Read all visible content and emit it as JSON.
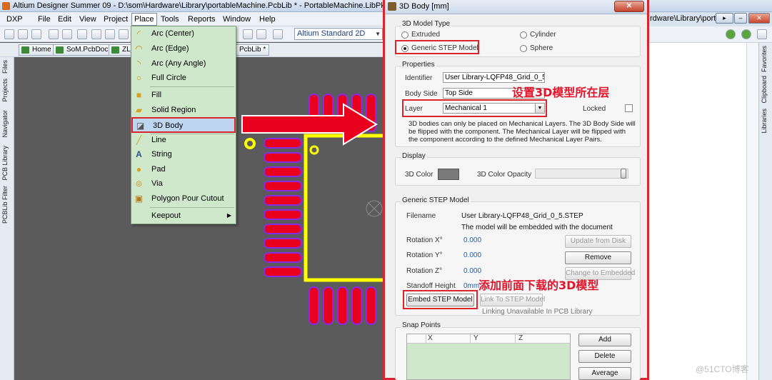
{
  "app": {
    "title": "Altium Designer Summer 09 - D:\\som\\Hardware\\Library\\portableMachine.PcbLib * - PortableMachine.LibPkg. Lice",
    "right_path": "rdware\\Library\\porta"
  },
  "menubar": [
    "DXP",
    "File",
    "Edit",
    "View",
    "Project",
    "Place",
    "Tools",
    "Reports",
    "Window",
    "Help"
  ],
  "toolbar": {
    "view_combo": "Altium Standard 2D"
  },
  "doc_tabs": [
    {
      "label": "Home"
    },
    {
      "label": "SoM.PcbDoc *"
    },
    {
      "label": "ZL_"
    },
    {
      "label": "PcbLib *"
    }
  ],
  "left_panel_tabs": [
    "Files",
    "Projects",
    "Navigator",
    "PCB Library",
    "PCBLib Filter"
  ],
  "right_panel_tabs": [
    "Favorites",
    "Clipboard",
    "Libraries"
  ],
  "place_menu": {
    "items": [
      {
        "label": "Arc (Center)",
        "icon": "arc-center-icon"
      },
      {
        "label": "Arc (Edge)",
        "icon": "arc-edge-icon"
      },
      {
        "label": "Arc (Any Angle)",
        "icon": "arc-any-angle-icon"
      },
      {
        "label": "Full Circle",
        "icon": "full-circle-icon"
      },
      {
        "label": "Fill",
        "icon": "fill-icon"
      },
      {
        "label": "Solid Region",
        "icon": "solid-region-icon"
      },
      {
        "label": "3D Body",
        "icon": "3d-body-icon",
        "selected": true
      },
      {
        "label": "Line",
        "icon": "line-icon"
      },
      {
        "label": "String",
        "icon": "string-icon"
      },
      {
        "label": "Pad",
        "icon": "pad-icon"
      },
      {
        "label": "Via",
        "icon": "via-icon"
      },
      {
        "label": "Polygon Pour Cutout",
        "icon": "polygon-cutout-icon"
      },
      {
        "label": "Keepout",
        "icon": "",
        "submenu": true
      }
    ]
  },
  "dialog": {
    "title": "3D Body [mm]",
    "model_type": {
      "group_title": "3D Model Type",
      "options": [
        {
          "label": "Extruded",
          "selected": false
        },
        {
          "label": "Cylinder",
          "selected": false
        },
        {
          "label": "Generic STEP Model",
          "selected": true
        },
        {
          "label": "Sphere",
          "selected": false
        }
      ]
    },
    "properties": {
      "group_title": "Properties",
      "identifier_label": "Identifier",
      "identifier_value": "User Library-LQFP48_Grid_0_5",
      "body_side_label": "Body Side",
      "body_side_value": "Top Side",
      "layer_label": "Layer",
      "layer_value": "Mechanical 1",
      "locked_label": "Locked",
      "note": "3D bodies can only be placed on Mechanical Layers. The 3D Body Side will be flipped with the component. The Mechanical Layer will be flipped with the component according to the defined Mechanical Layer Pairs."
    },
    "display": {
      "group_title": "Display",
      "color_label": "3D Color",
      "color_value": "#7a7a7a",
      "opacity_label": "3D Color Opacity",
      "opacity_fraction": 1.0
    },
    "step_model": {
      "group_title": "Generic STEP Model",
      "filename_label": "Filename",
      "filename_value": "User Library-LQFP48_Grid_0_5.STEP",
      "embedded_note": "The model will be embedded with the document",
      "rotation_x_label": "Rotation X°",
      "rotation_x_value": "0.000",
      "rotation_y_label": "Rotation Y°",
      "rotation_y_value": "0.000",
      "rotation_z_label": "Rotation Z°",
      "rotation_z_value": "0.000",
      "standoff_label": "Standoff Height",
      "standoff_value": "0mm",
      "btn_update": "Update from Disk",
      "btn_remove": "Remove",
      "btn_change": "Change to Embedded",
      "btn_embed": "Embed STEP Model",
      "btn_link": "Link To STEP Model",
      "link_note": "Linking Unavailable In PCB Library"
    },
    "snap_points": {
      "group_title": "Snap Points",
      "columns": [
        "X",
        "Y",
        "Z"
      ],
      "btn_add": "Add",
      "btn_delete": "Delete",
      "btn_average": "Average"
    }
  },
  "annotations": {
    "layer_note": "设置3D模型所在层",
    "step_note": "添加前面下载的3D模型"
  },
  "watermark": "@51CTO博客",
  "colors": {
    "accent_red": "#d9252b",
    "pad_red": "#e8001c",
    "silk_yellow": "#ffff00",
    "pad_outline": "#8a2be2"
  }
}
